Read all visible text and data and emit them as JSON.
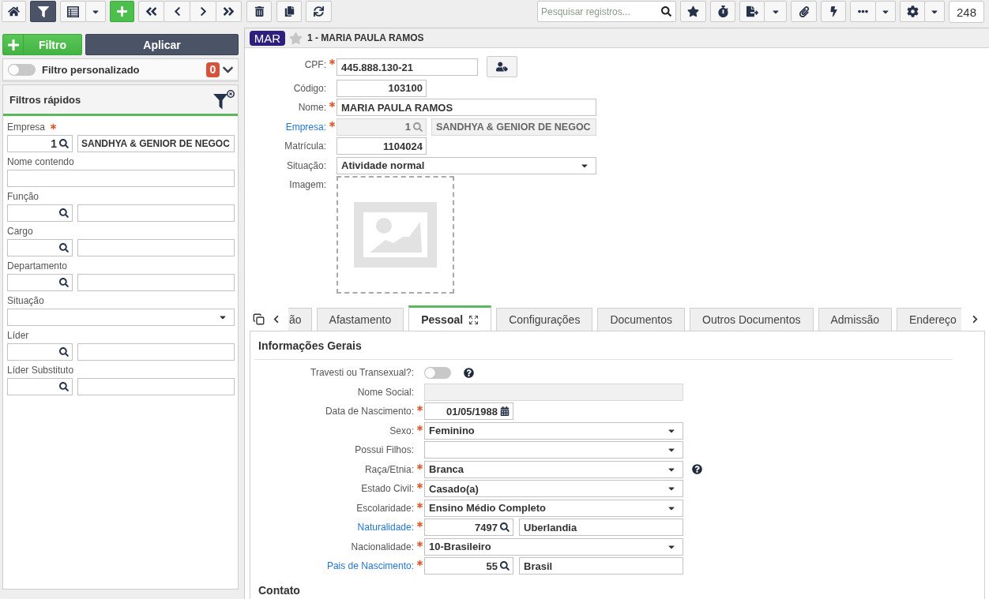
{
  "toolbar": {
    "filter_active": true,
    "search": {
      "placeholder": "Pesquisar registros..."
    },
    "record_count": "248"
  },
  "filter_panel": {
    "add_button": "Filtro",
    "apply_button": "Aplicar",
    "custom_filter": {
      "label": "Filtro personalizado",
      "on": false,
      "count": "0"
    },
    "quick_filters": {
      "title": "Filtros rápidos",
      "fields": [
        {
          "kind": "lookup",
          "label": "Empresa",
          "required": true,
          "code": "1",
          "description": "SANDHYA & GENIOR DE NEGOC"
        },
        {
          "kind": "text",
          "label": "Nome contendo",
          "required": false
        },
        {
          "kind": "lookup",
          "label": "Função",
          "required": false
        },
        {
          "kind": "lookup",
          "label": "Cargo",
          "required": false
        },
        {
          "kind": "lookup",
          "label": "Departamento",
          "required": false
        },
        {
          "kind": "select",
          "label": "Situação",
          "required": false
        },
        {
          "kind": "lookup",
          "label": "Líder",
          "required": false
        },
        {
          "kind": "lookup",
          "label": "Líder Substituto",
          "required": false
        }
      ]
    }
  },
  "record": {
    "badge": "MAR",
    "favorite": false,
    "title": "1 - MARIA PAULA RAMOS",
    "fields": [
      {
        "kind": "document",
        "label": "CPF:",
        "required": true,
        "disabled": false,
        "value": "445.888.130-21"
      },
      {
        "kind": "code",
        "label": "Código:",
        "required": false,
        "disabled": false,
        "value": "103100"
      },
      {
        "kind": "text",
        "label": "Nome:",
        "required": true,
        "disabled": false,
        "value": "MARIA PAULA RAMOS"
      },
      {
        "kind": "lookup",
        "label": "Empresa:",
        "required": true,
        "disabled": true,
        "code": "1",
        "description": "SANDHYA & GENIOR DE NEGOC"
      },
      {
        "kind": "code",
        "label": "Matrícula:",
        "required": false,
        "disabled": false,
        "value": "1104024"
      },
      {
        "kind": "select",
        "label": "Situação:",
        "required": false,
        "disabled": false,
        "value": "Atividade normal"
      },
      {
        "kind": "image",
        "label": "Imagem:",
        "required": false,
        "disabled": false
      }
    ]
  },
  "tabs": [
    {
      "label": "ão",
      "selected": false
    },
    {
      "label": "Afastamento",
      "selected": false
    },
    {
      "label": "Pessoal",
      "selected": true
    },
    {
      "label": "Configurações",
      "selected": false
    },
    {
      "label": "Documentos",
      "selected": false
    },
    {
      "label": "Outros Documentos",
      "selected": false
    },
    {
      "label": "Admissão",
      "selected": false
    },
    {
      "label": "Endereço",
      "selected": false
    }
  ],
  "tab_content": {
    "sections": [
      {
        "title": "Informações Gerais",
        "fields": [
          {
            "kind": "toggle",
            "label": "Travesti ou Transexual?:",
            "required": false,
            "disabled": false,
            "on": false,
            "help": true
          },
          {
            "kind": "text",
            "label": "Nome Social:",
            "required": false,
            "disabled": true,
            "help": false
          },
          {
            "kind": "date",
            "label": "Data de Nascimento:",
            "required": true,
            "disabled": false,
            "value": "01/05/1988",
            "help": false
          },
          {
            "kind": "select",
            "label": "Sexo:",
            "required": true,
            "disabled": false,
            "value": "Feminino",
            "help": false
          },
          {
            "kind": "select",
            "label": "Possui Filhos:",
            "required": false,
            "disabled": false,
            "help": false
          },
          {
            "kind": "select",
            "label": "Raça/Etnia:",
            "required": true,
            "disabled": false,
            "value": "Branca",
            "help": true
          },
          {
            "kind": "select",
            "label": "Estado Civil:",
            "required": true,
            "disabled": false,
            "value": "Casado(a)",
            "help": false
          },
          {
            "kind": "select",
            "label": "Escolaridade:",
            "required": true,
            "disabled": false,
            "value": "Ensino Médio Completo",
            "help": false
          },
          {
            "kind": "lookup",
            "label": "Naturalidade:",
            "required": true,
            "disabled": false,
            "code": "7497",
            "description": "Uberlandia",
            "help": false
          },
          {
            "kind": "select",
            "label": "Nacionalidade:",
            "required": true,
            "disabled": false,
            "value": "10-Brasileiro",
            "help": false
          },
          {
            "kind": "lookup",
            "label": "Pais de Nascimento:",
            "required": true,
            "disabled": false,
            "code": "55",
            "description": "Brasil",
            "help": false
          }
        ]
      },
      {
        "title": "Contato"
      }
    ]
  }
}
